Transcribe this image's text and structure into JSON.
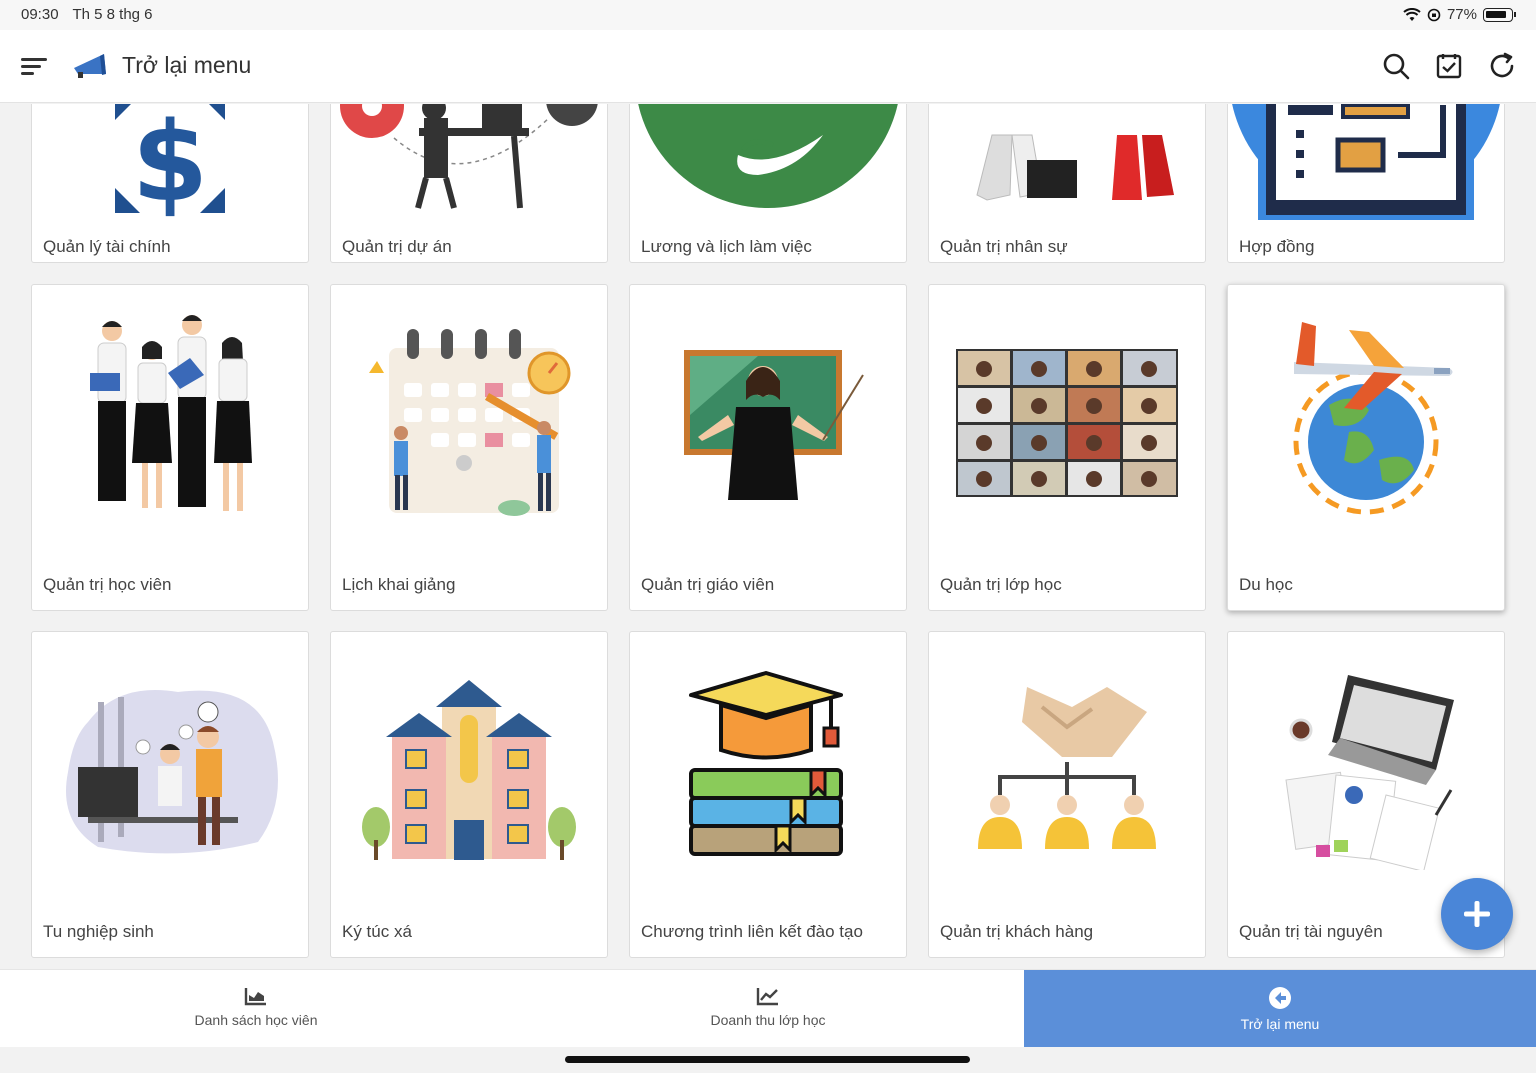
{
  "status": {
    "time": "09:30",
    "date": "Th 5 8 thg 6",
    "battery": "77%"
  },
  "header": {
    "title": "Trở lại menu"
  },
  "cards": [
    {
      "label": "Quản lý tài chính",
      "icon": "dollar-icon"
    },
    {
      "label": "Quản trị dự án",
      "icon": "project-icon"
    },
    {
      "label": "Lương và lịch làm việc",
      "icon": "salary-icon"
    },
    {
      "label": "Quản trị nhân sự",
      "icon": "hr-icon"
    },
    {
      "label": "Hợp đồng",
      "icon": "contract-icon"
    },
    {
      "label": "Quản trị học viên",
      "icon": "students-icon"
    },
    {
      "label": "Lịch khai giảng",
      "icon": "calendar-icon"
    },
    {
      "label": "Quản trị giáo viên",
      "icon": "teacher-icon"
    },
    {
      "label": "Quản trị lớp học",
      "icon": "class-grid-icon"
    },
    {
      "label": "Du học",
      "icon": "study-abroad-icon"
    },
    {
      "label": "Tu nghiệp sinh",
      "icon": "trainee-icon"
    },
    {
      "label": "Ký túc xá",
      "icon": "dormitory-icon"
    },
    {
      "label": "Chương trình liên kết đào tạo",
      "icon": "graduation-icon"
    },
    {
      "label": "Quản trị khách hàng",
      "icon": "handshake-icon"
    },
    {
      "label": "Quản trị tài nguyên",
      "icon": "resources-icon"
    }
  ],
  "bottom_nav": [
    {
      "label": "Danh sách học viên",
      "icon": "chart-area-icon"
    },
    {
      "label": "Doanh thu lớp học",
      "icon": "chart-line-icon"
    },
    {
      "label": "Trở lại menu",
      "icon": "back-arrow-icon"
    }
  ],
  "colors": {
    "accent": "#5b8fd9",
    "fab": "#4a86d8"
  }
}
